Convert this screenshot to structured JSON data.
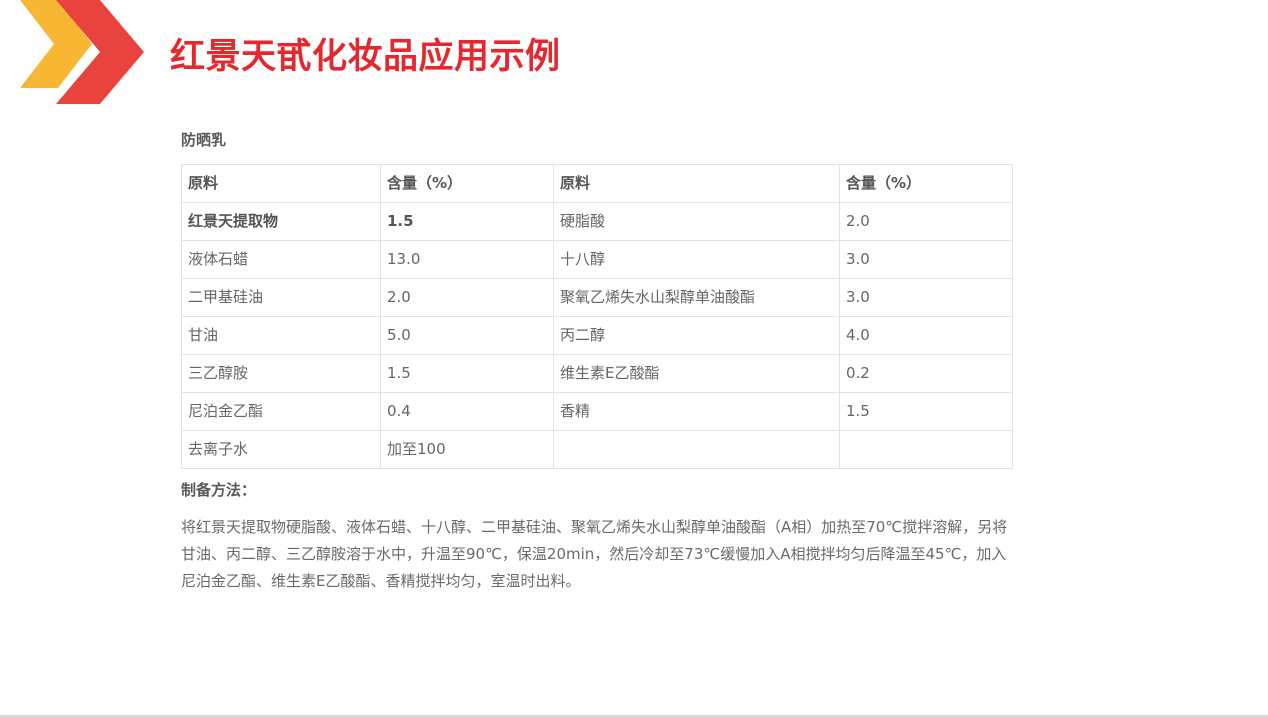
{
  "title": "红景天甙化妆品应用示例",
  "section_title": "防晒乳",
  "colors": {
    "title": "#e5282d",
    "chevron_back": "#f7b733",
    "chevron_front": "#e9433e"
  },
  "table": {
    "headers": [
      "原料",
      "含量（%）",
      "原料",
      "含量（%）"
    ],
    "rows": [
      [
        "红景天提取物",
        "1.5",
        "硬脂酸",
        "2.0"
      ],
      [
        "液体石蜡",
        "13.0",
        "十八醇",
        "3.0"
      ],
      [
        "二甲基硅油",
        "2.0",
        "聚氧乙烯失水山梨醇单油酸酯",
        "3.0"
      ],
      [
        "甘油",
        "5.0",
        "丙二醇",
        "4.0"
      ],
      [
        "三乙醇胺",
        "1.5",
        "维生素E乙酸酯",
        "0.2"
      ],
      [
        "尼泊金乙酯",
        "0.4",
        "香精",
        "1.5"
      ],
      [
        "去离子水",
        "加至100",
        "",
        ""
      ]
    ]
  },
  "method": {
    "title": "制备方法：",
    "text": "将红景天提取物硬脂酸、液体石蜡、十八醇、二甲基硅油、聚氧乙烯失水山梨醇单油酸酯（A相）加热至70℃搅拌溶解，另将甘油、丙二醇、三乙醇胺溶于水中，升温至90℃，保温20min，然后冷却至73℃缓慢加入A相搅拌均匀后降温至45℃，加入尼泊金乙酯、维生素E乙酸酯、香精搅拌均匀，室温时出料。"
  }
}
